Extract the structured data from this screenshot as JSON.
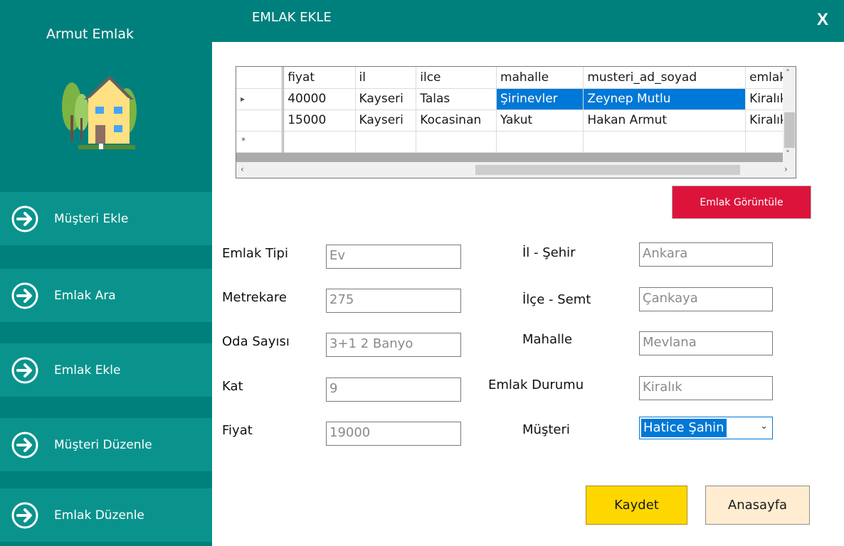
{
  "app": {
    "title": "Armut Emlak"
  },
  "header": {
    "title": "EMLAK EKLE",
    "close_label": "X"
  },
  "sidebar": {
    "items": [
      {
        "label": "Müşteri Ekle"
      },
      {
        "label": "Emlak Ara"
      },
      {
        "label": "Emlak Ekle"
      },
      {
        "label": "Müşteri Düzenle"
      },
      {
        "label": "Emlak Düzenle"
      }
    ]
  },
  "grid": {
    "columns": [
      "fiyat",
      "il",
      "ilce",
      "mahalle",
      "musteri_ad_soyad",
      "emlak"
    ],
    "rows": [
      [
        "40000",
        "Kayseri",
        "Talas",
        "Şirinevler",
        "Zeynep Mutlu",
        "Kiralık"
      ],
      [
        "15000",
        "Kayseri",
        "Kocasinan",
        "Yakut",
        "Hakan Armut",
        "Kiralık"
      ]
    ],
    "new_row_marker": "*",
    "current_row_marker": "▸"
  },
  "buttons": {
    "view": "Emlak Görüntüle",
    "save": "Kaydet",
    "home": "Anasayfa"
  },
  "form": {
    "emlak_tipi": {
      "label": "Emlak Tipi",
      "value": "Ev"
    },
    "metrekare": {
      "label": "Metrekare",
      "value": "275"
    },
    "oda_sayisi": {
      "label": "Oda Sayısı",
      "value": "3+1 2 Banyo"
    },
    "kat": {
      "label": "Kat",
      "value": "9"
    },
    "fiyat": {
      "label": "Fiyat",
      "value": "19000"
    },
    "il": {
      "label": "İl - Şehir",
      "value": "Ankara"
    },
    "ilce": {
      "label": "İlçe - Semt",
      "value": "Çankaya"
    },
    "mahalle": {
      "label": "Mahalle",
      "value": "Mevlana"
    },
    "durum": {
      "label": "Emlak Durumu",
      "value": "Kiralık"
    },
    "musteri": {
      "label": "Müşteri",
      "value": "Hatice Şahin"
    }
  },
  "colors": {
    "teal": "#00807d",
    "teal_light": "#0a938d",
    "crimson": "#dc143c",
    "gold": "#ffd700",
    "selection": "#0078d7"
  },
  "icons": [
    "house-logo-icon",
    "arrow-right-circle-icon",
    "close-icon",
    "chevron-down-icon"
  ]
}
